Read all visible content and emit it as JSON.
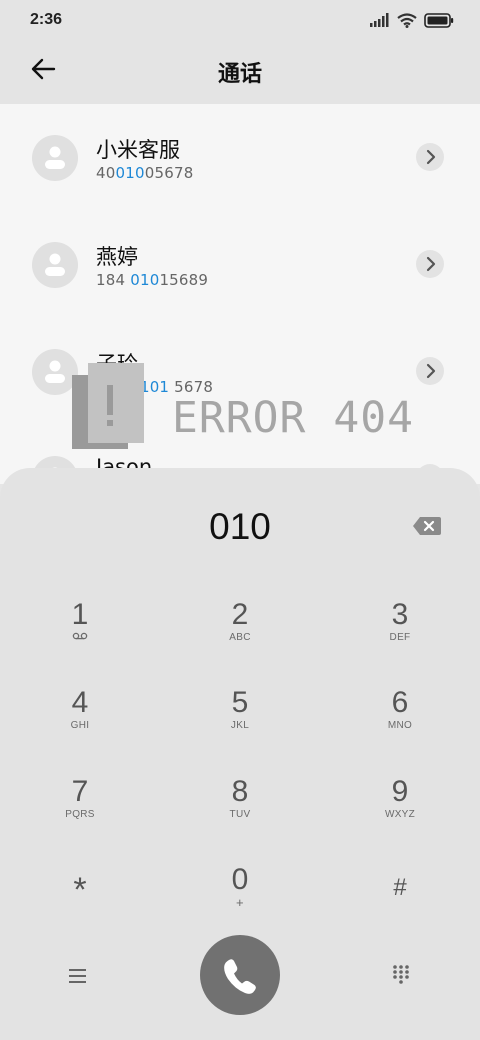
{
  "status": {
    "time": "2:36"
  },
  "header": {
    "title": "通话"
  },
  "contacts": [
    {
      "name": "小米客服",
      "num_pre": "40",
      "num_hl": "010",
      "num_post": "05678"
    },
    {
      "name": "燕婷",
      "num_pre": "184 ",
      "num_hl": "010",
      "num_post": "15689"
    },
    {
      "name": "子玲",
      "num_pre": "184 ",
      "num_hl": "0101",
      "num_post": " 5678"
    },
    {
      "name": "Jason",
      "num_pre": "",
      "num_hl": "",
      "num_post": ""
    }
  ],
  "overlay": {
    "error_text": "ERROR 404"
  },
  "dialer": {
    "input": "010",
    "keys": [
      {
        "digit": "1",
        "letters": ""
      },
      {
        "digit": "2",
        "letters": "ABC"
      },
      {
        "digit": "3",
        "letters": "DEF"
      },
      {
        "digit": "4",
        "letters": "GHI"
      },
      {
        "digit": "5",
        "letters": "JKL"
      },
      {
        "digit": "6",
        "letters": "MNO"
      },
      {
        "digit": "7",
        "letters": "PQRS"
      },
      {
        "digit": "8",
        "letters": "TUV"
      },
      {
        "digit": "9",
        "letters": "WXYZ"
      },
      {
        "digit": "*",
        "letters": ""
      },
      {
        "digit": "0",
        "letters": "+"
      },
      {
        "digit": "#",
        "letters": ""
      }
    ]
  },
  "colors": {
    "highlight": "#1e88d6",
    "call_button": "#717171"
  }
}
